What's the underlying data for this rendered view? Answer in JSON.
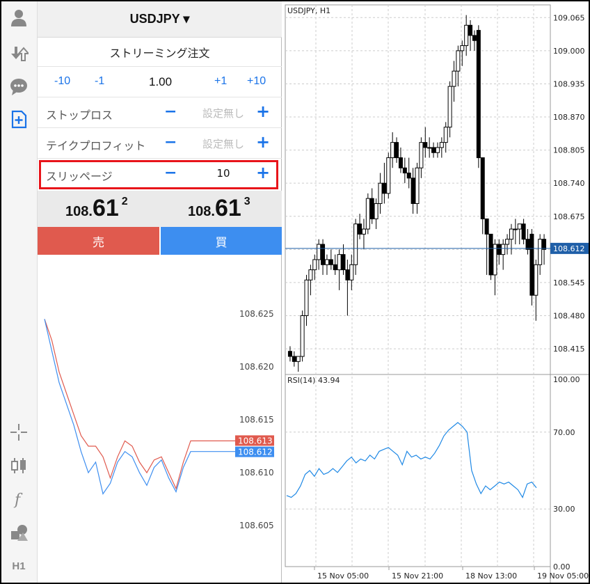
{
  "symbol_bar": {
    "symbol": "USDJPY ▾"
  },
  "order_panel": {
    "mode_title": "ストリーミング注文",
    "volume": {
      "minus10": "-10",
      "minus1": "-1",
      "value": "1.00",
      "plus1": "+1",
      "plus10": "+10"
    },
    "stop_loss": {
      "label": "ストップロス",
      "value": "設定無し",
      "minus": "−",
      "plus": "+"
    },
    "take_profit": {
      "label": "テイクプロフィット",
      "value": "設定無し",
      "minus": "−",
      "plus": "+"
    },
    "slippage": {
      "label": "スリッページ",
      "value": "10",
      "minus": "−",
      "plus": "+"
    },
    "bid": {
      "prefix": "108.",
      "big": "61",
      "sup": "2"
    },
    "ask": {
      "prefix": "108.",
      "big": "61",
      "sup": "3"
    },
    "sell_label": "売",
    "buy_label": "買"
  },
  "rail_icons": [
    "user-icon",
    "trade-icon",
    "chat-icon",
    "new-order-icon",
    "crosshair-icon",
    "candlestick-icon",
    "function-icon",
    "objects-icon",
    "timeframe-icon"
  ],
  "rail_timeframe_label": "H1",
  "colors": {
    "sell": "#e05a4e",
    "buy": "#3d8ef0",
    "highlight": "#e8141a",
    "rsi": "#1e88e5",
    "bid_line": "#1f5fa8"
  },
  "tick_chart": {
    "y_labels": [
      "108.625",
      "108.620",
      "108.615",
      "108.610",
      "108.605"
    ],
    "ask_label": "108.613",
    "bid_label": "108.612"
  },
  "chart_data": [
    {
      "type": "candlestick",
      "title": "USDJPY, H1",
      "y_ticks": [
        "109.065",
        "109.000",
        "108.935",
        "108.870",
        "108.805",
        "108.740",
        "108.675",
        "108.610",
        "108.545",
        "108.480",
        "108.415"
      ],
      "ylim": [
        108.37,
        109.09
      ],
      "current_price_label": "108.612",
      "candles": [
        [
          108.41,
          108.42,
          108.39,
          108.4
        ],
        [
          108.4,
          108.41,
          108.38,
          108.39
        ],
        [
          108.39,
          108.4,
          108.37,
          108.4
        ],
        [
          108.4,
          108.49,
          108.39,
          108.48
        ],
        [
          108.48,
          108.56,
          108.46,
          108.55
        ],
        [
          108.55,
          108.58,
          108.52,
          108.57
        ],
        [
          108.57,
          108.6,
          108.55,
          108.59
        ],
        [
          108.59,
          108.63,
          108.57,
          108.62
        ],
        [
          108.62,
          108.63,
          108.56,
          108.58
        ],
        [
          108.58,
          108.6,
          108.56,
          108.59
        ],
        [
          108.59,
          108.61,
          108.57,
          108.58
        ],
        [
          108.58,
          108.6,
          108.56,
          108.57
        ],
        [
          108.57,
          108.61,
          108.53,
          108.6
        ],
        [
          108.6,
          108.62,
          108.56,
          108.57
        ],
        [
          108.57,
          108.59,
          108.48,
          108.55
        ],
        [
          108.55,
          108.6,
          108.53,
          108.58
        ],
        [
          108.58,
          108.67,
          108.56,
          108.66
        ],
        [
          108.66,
          108.68,
          108.63,
          108.64
        ],
        [
          108.64,
          108.67,
          108.61,
          108.65
        ],
        [
          108.65,
          108.72,
          108.64,
          108.71
        ],
        [
          108.71,
          108.73,
          108.66,
          108.67
        ],
        [
          108.67,
          108.71,
          108.65,
          108.7
        ],
        [
          108.7,
          108.76,
          108.68,
          108.74
        ],
        [
          108.74,
          108.78,
          108.7,
          108.72
        ],
        [
          108.72,
          108.8,
          108.71,
          108.79
        ],
        [
          108.79,
          108.84,
          108.77,
          108.82
        ],
        [
          108.82,
          108.83,
          108.78,
          108.79
        ],
        [
          108.79,
          108.81,
          108.76,
          108.77
        ],
        [
          108.77,
          108.79,
          108.74,
          108.76
        ],
        [
          108.76,
          108.79,
          108.73,
          108.75
        ],
        [
          108.75,
          108.77,
          108.68,
          108.7
        ],
        [
          108.7,
          108.78,
          108.68,
          108.77
        ],
        [
          108.77,
          108.83,
          108.75,
          108.82
        ],
        [
          108.82,
          108.85,
          108.79,
          108.81
        ],
        [
          108.81,
          108.83,
          108.79,
          108.81
        ],
        [
          108.81,
          108.82,
          108.79,
          108.8
        ],
        [
          108.8,
          108.82,
          108.79,
          108.81
        ],
        [
          108.81,
          108.83,
          108.79,
          108.82
        ],
        [
          108.82,
          108.86,
          108.8,
          108.85
        ],
        [
          108.85,
          108.94,
          108.83,
          108.93
        ],
        [
          108.93,
          108.98,
          108.9,
          108.96
        ],
        [
          108.96,
          109.01,
          108.93,
          109.0
        ],
        [
          109.0,
          109.02,
          108.97,
          109.01
        ],
        [
          109.01,
          109.07,
          108.99,
          109.05
        ],
        [
          109.05,
          109.06,
          109.0,
          109.03
        ],
        [
          109.03,
          109.04,
          109.0,
          109.02
        ],
        [
          109.04,
          109.05,
          108.77,
          108.79
        ],
        [
          108.79,
          108.79,
          108.64,
          108.67
        ],
        [
          108.67,
          108.67,
          108.56,
          108.64
        ],
        [
          108.64,
          108.64,
          108.55,
          108.56
        ],
        [
          108.56,
          108.63,
          108.52,
          108.62
        ],
        [
          108.62,
          108.63,
          108.58,
          108.6
        ],
        [
          108.6,
          108.63,
          108.57,
          108.62
        ],
        [
          108.62,
          108.64,
          108.6,
          108.63
        ],
        [
          108.63,
          108.66,
          108.6,
          108.65
        ],
        [
          108.65,
          108.67,
          108.62,
          108.65
        ],
        [
          108.65,
          108.66,
          108.62,
          108.66
        ],
        [
          108.66,
          108.67,
          108.62,
          108.63
        ],
        [
          108.63,
          108.65,
          108.6,
          108.61
        ],
        [
          108.64,
          108.65,
          108.5,
          108.52
        ],
        [
          108.52,
          108.59,
          108.47,
          108.58
        ],
        [
          108.58,
          108.64,
          108.56,
          108.63
        ],
        [
          108.63,
          108.64,
          108.58,
          108.61
        ]
      ]
    },
    {
      "type": "line",
      "title": "RSI(14) 43.94",
      "y_ticks": [
        "100.00",
        "70.00",
        "30.00",
        "0.00"
      ],
      "ylim": [
        0,
        100
      ],
      "x_labels": [
        "15 Nov 05:00",
        "15 Nov 21:00",
        "18 Nov 13:00",
        "19 Nov 05:00"
      ],
      "series": [
        {
          "values": [
            37,
            36,
            38,
            42,
            48,
            50,
            47,
            51,
            48,
            49,
            51,
            49,
            52,
            55,
            57,
            54,
            56,
            55,
            58,
            56,
            60,
            61,
            62,
            60,
            58,
            53,
            60,
            57,
            58,
            56,
            57,
            56,
            59,
            63,
            68,
            71,
            73,
            75,
            73,
            70,
            50,
            43,
            38,
            42,
            40,
            42,
            44,
            43,
            44,
            42,
            40,
            36,
            43,
            44,
            41
          ]
        }
      ]
    }
  ],
  "tick_series": {
    "ask": [
      108.6245,
      108.6225,
      108.6195,
      108.6175,
      108.6155,
      108.6135,
      108.6125,
      108.6125,
      108.6115,
      108.6095,
      108.6115,
      108.613,
      108.6125,
      108.611,
      108.61,
      108.6112,
      108.6115,
      108.61,
      108.6085,
      108.611,
      108.613,
      108.613,
      108.613,
      108.613,
      108.613,
      108.613,
      108.613,
      108.613
    ],
    "bid": [
      108.6245,
      108.6215,
      108.6185,
      108.6165,
      108.6145,
      108.612,
      108.61,
      108.611,
      108.608,
      108.609,
      108.611,
      108.612,
      108.6115,
      108.61,
      108.6088,
      108.6105,
      108.6112,
      108.6095,
      108.6082,
      108.6105,
      108.612,
      108.612,
      108.612,
      108.612,
      108.612,
      108.612,
      108.612,
      108.612
    ]
  }
}
